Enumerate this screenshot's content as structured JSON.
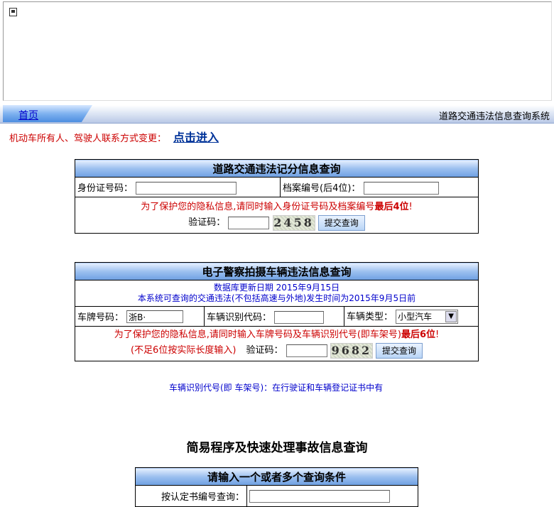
{
  "nav": {
    "home_label": "首页",
    "system_title": "道路交通违法信息查询系统"
  },
  "contact": {
    "text": "机动车所有人、驾驶人联系方式变更：",
    "link": "点击进入"
  },
  "points_query": {
    "title": "道路交通违法记分信息查询",
    "id_label": "身份证号码：",
    "id_value": "",
    "file_label": "档案编号(后4位)：",
    "file_value": "",
    "privacy_note_pre": "为了保护您的隐私信息,请同时输入身份证号码及档案编号",
    "privacy_note_bold": "最后4位",
    "privacy_note_post": "!",
    "captcha_label": "验证码：",
    "captcha_value": "",
    "captcha_image_text": "2458",
    "submit_label": "提交查询"
  },
  "camera_query": {
    "title": "电子警察拍摄车辆违法信息查询",
    "db_update": "数据库更新日期  2015年9月15日",
    "scope_note": "本系统可查询的交通违法(不包括高速与外地)发生时间为2015年9月5日前",
    "plate_label": "车牌号码：",
    "plate_value": "浙B·",
    "vin_label": "车辆识别代码：",
    "vin_value": "",
    "type_label": "车辆类型：",
    "type_selected": "小型汽车",
    "privacy_note_pre": "为了保护您的隐私信息,请同时输入车牌号码及车辆识别代号(即车架号)",
    "privacy_note_bold": "最后6位",
    "privacy_note_post": "!",
    "short_note": "(不足6位按实际长度输入)",
    "captcha_label": "验证码：",
    "captcha_value": "",
    "captcha_image_text": "9682",
    "submit_label": "提交查询"
  },
  "vin_note": "车辆识别代号(即 车架号)：在行驶证和车辆登记证书中有",
  "accident": {
    "title": "简易程序及快速处理事故信息查询",
    "subtitle": "请输入一个或者多个查询条件",
    "cert_label": "按认定书编号查询：",
    "cert_value": ""
  }
}
